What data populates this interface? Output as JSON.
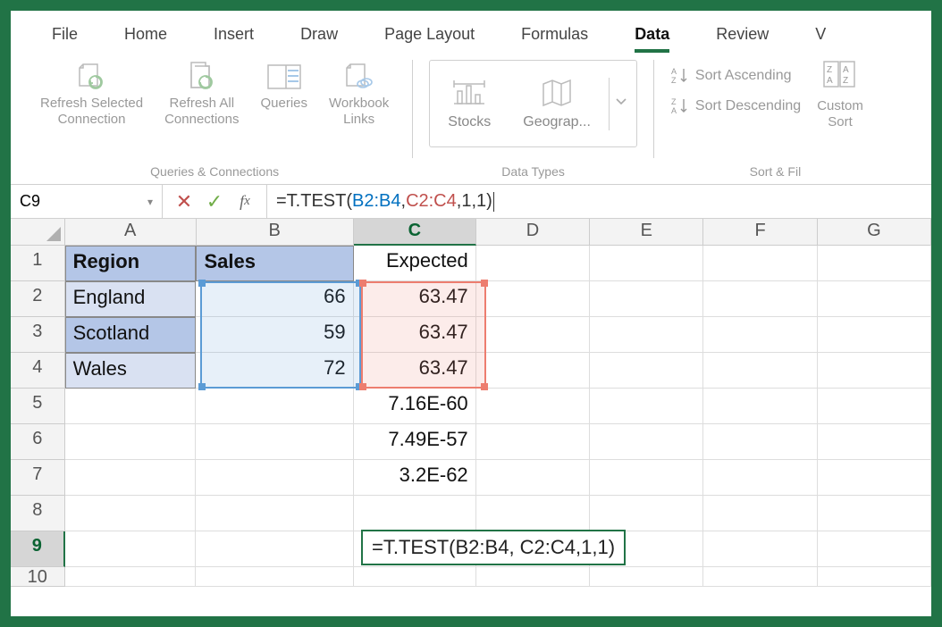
{
  "ribbon": {
    "tabs": [
      "File",
      "Home",
      "Insert",
      "Draw",
      "Page Layout",
      "Formulas",
      "Data",
      "Review",
      "V"
    ],
    "active_tab": "Data",
    "groups": {
      "queries": {
        "label": "Queries & Connections",
        "refresh_selected": "Refresh Selected\nConnection",
        "refresh_all": "Refresh All\nConnections",
        "queries": "Queries",
        "workbook_links": "Workbook\nLinks"
      },
      "data_types": {
        "label": "Data Types",
        "stocks": "Stocks",
        "geography": "Geograp..."
      },
      "sort": {
        "label": "Sort & Fil",
        "asc": "Sort Ascending",
        "desc": "Sort Descending",
        "custom": "Custom\nSort"
      }
    }
  },
  "formula_bar": {
    "name_box": "C9",
    "formula_prefix": "=T.TEST(",
    "ref1": "B2:B4",
    "sep1": ", ",
    "ref2": "C2:C4",
    "suffix": ",1,1)"
  },
  "sheet": {
    "columns": [
      "A",
      "B",
      "C",
      "D",
      "E",
      "F",
      "G"
    ],
    "col_widths": {
      "A": 150,
      "B": 180,
      "C": 140,
      "D": 130,
      "E": 130,
      "F": 130,
      "G": 130
    },
    "rows": [
      {
        "n": 1,
        "A": "Region",
        "B": "Sales",
        "C": "Expected"
      },
      {
        "n": 2,
        "A": "England",
        "B": "66",
        "C": "63.47"
      },
      {
        "n": 3,
        "A": "Scotland",
        "B": "59",
        "C": "63.47"
      },
      {
        "n": 4,
        "A": "Wales",
        "B": "72",
        "C": "63.47"
      },
      {
        "n": 5,
        "C": "7.16E-60"
      },
      {
        "n": 6,
        "C": "7.49E-57"
      },
      {
        "n": 7,
        "C": "3.2E-62"
      },
      {
        "n": 8
      },
      {
        "n": 9,
        "C_formula": "=T.TEST(B2:B4, C2:C4,1,1)"
      },
      {
        "n": 10
      }
    ],
    "active_cell": "C9",
    "highlight_blue": "B2:B4",
    "highlight_red": "C2:C4"
  }
}
